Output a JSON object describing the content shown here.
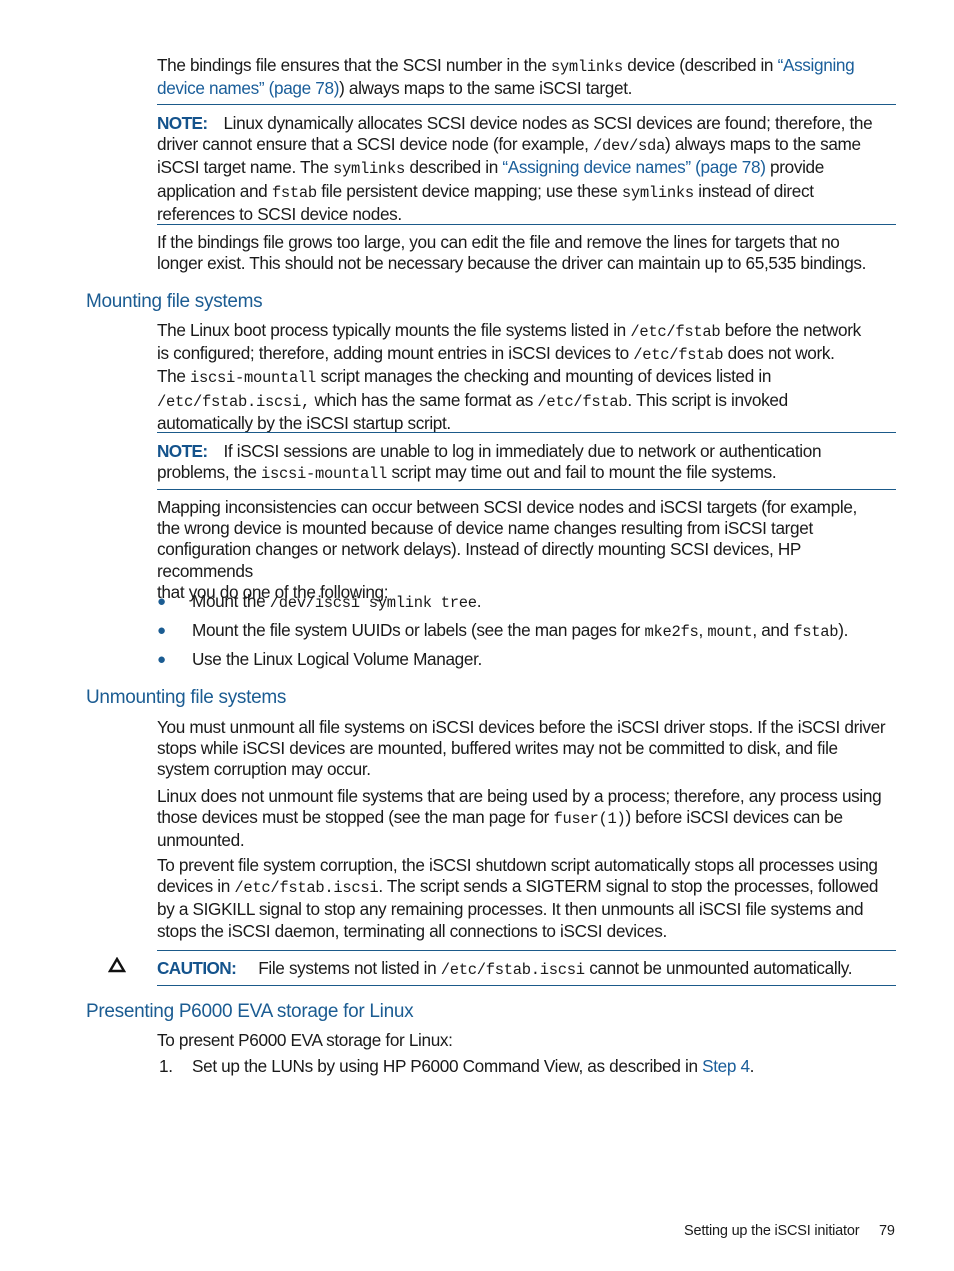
{
  "page": {
    "footer": {
      "section_title": "Setting up the iSCSI initiator",
      "page_number": "79"
    }
  },
  "intro": {
    "p1": {
      "t1": "The bindings file ensures that the SCSI number in the ",
      "c1": "symlinks",
      "t2": " device (described in ",
      "link1a": "“Assigning",
      "link1b": "device names” (page 78)",
      "t3": ") always maps to the same iSCSI target."
    },
    "note1": {
      "label": "NOTE:",
      "t1": "Linux dynamically allocates SCSI device nodes as SCSI devices are found; therefore, the",
      "t2": "driver cannot ensure that a SCSI device node (for example, ",
      "c1": "/dev/sda",
      "t3": ") always maps to the same",
      "t4": "iSCSI target name. The ",
      "c2": "symlinks",
      "t5": " described in ",
      "link": "“Assigning device names” (page 78)",
      "t6": " provide",
      "t7": "application and ",
      "c3": "fstab",
      "t8": " file persistent device mapping; use these ",
      "c4": "symlinks",
      "t9": " instead of direct",
      "t10": "references to SCSI device nodes."
    },
    "p2": {
      "l1": "If the bindings file grows too large, you can edit the file and remove the lines for targets that no",
      "l2": "longer exist. This should not be necessary because the driver can maintain up to 65,535 bindings."
    }
  },
  "mounting": {
    "heading": "Mounting file systems",
    "p1": {
      "t1": "The Linux boot process typically mounts the file systems listed in ",
      "c1": "/etc/fstab",
      "t2": " before the network",
      "t3": "is configured; therefore, adding mount entries in iSCSI devices to ",
      "c2": "/etc/fstab",
      "t4": " does not work.",
      "t5": "The ",
      "c3": "iscsi-mountall",
      "t6": "  script manages the checking and mounting of devices listed in",
      "c4": "/etc/fstab.iscsi,",
      "t7": " which has the same format as ",
      "c5": "/etc/fstab",
      "t8": ". This script is invoked",
      "t9": "automatically by the iSCSI startup script."
    },
    "note": {
      "label": "NOTE:",
      "t1": "If iSCSI sessions are unable to log in immediately due to network or authentication",
      "t2": "problems, the ",
      "c1": "iscsi-mountall",
      "t3": " script may time out and fail to mount the file systems."
    },
    "p2": {
      "l1": "Mapping inconsistencies can occur between SCSI device nodes and iSCSI targets (for example,",
      "l2": "the wrong device is mounted because of device name changes resulting from iSCSI target",
      "l3": "configuration changes or network delays). Instead of directly mounting SCSI devices, HP recommends",
      "l4": "that you do one of the following:"
    },
    "bullets": [
      {
        "t1": "Mount the ",
        "c1": "/dev/iscsi symlink tree",
        "t2": "."
      },
      {
        "t1": "Mount the file system UUIDs or labels (see the man pages for ",
        "c1": "mke2fs",
        "t2": ", ",
        "c2": "mount",
        "t3": ", and ",
        "c3": "fstab",
        "t4": ")."
      },
      {
        "t1": "Use the Linux Logical Volume Manager."
      }
    ]
  },
  "unmounting": {
    "heading": "Unmounting file systems",
    "p1": {
      "l1": "You must unmount all file systems on iSCSI devices before the iSCSI driver stops. If the iSCSI driver",
      "l2": "stops while iSCSI devices are mounted, buffered writes may not be committed to disk, and file",
      "l3": "system corruption may occur."
    },
    "p2": {
      "l1": "Linux does not unmount file systems that are being used by a process; therefore, any process using",
      "t1": "those devices must be stopped (see the man page for ",
      "c1": "fuser(1)",
      "t2": ") before iSCSI devices can be",
      "l3": "unmounted."
    },
    "p3": {
      "l1": "To prevent file system corruption, the iSCSI shutdown script automatically stops all processes using",
      "t1": "devices in  ",
      "c1": "/etc/fstab.iscsi",
      "t2": ". The script sends a SIGTERM signal to stop the processes, followed",
      "l3": "by a SIGKILL signal to stop any remaining processes. It then unmounts all iSCSI file systems and",
      "l4": "stops the iSCSI daemon, terminating all connections to iSCSI devices."
    },
    "caution": {
      "icon": "caution-triangle-icon",
      "label": "CAUTION:",
      "t1": "File systems not listed in ",
      "c1": "/etc/fstab.iscsi",
      "t2": " cannot be unmounted automatically."
    }
  },
  "presenting": {
    "heading": "Presenting P6000 EVA storage for Linux",
    "intro": "To present P6000 EVA storage for Linux:",
    "steps": [
      {
        "num": "1.",
        "t1": "Set up the LUNs by using HP P6000 Command View, as described in ",
        "link": "Step 4",
        "t2": "."
      }
    ]
  },
  "colors": {
    "heading_blue": "#1b5c92",
    "link_blue": "#1a5e9a",
    "rule_blue": "#1b5a8a",
    "text": "#1a1a1a"
  }
}
